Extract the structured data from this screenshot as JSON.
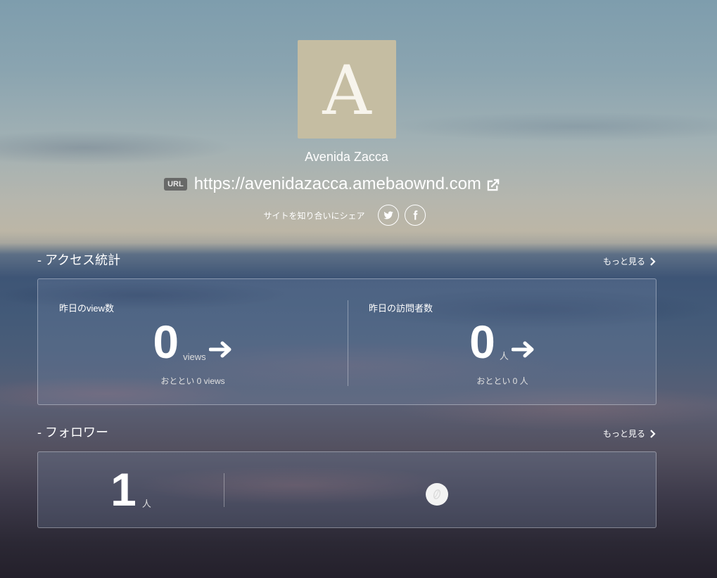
{
  "profile": {
    "avatar_letter": "A",
    "name": "Avenida Zacca",
    "url_badge": "URL",
    "url": "https://avenidazacca.amebaownd.com",
    "share_label": "サイトを知り合いにシェア",
    "social_icons": [
      "twitter-icon",
      "facebook-icon"
    ]
  },
  "access": {
    "title": "- アクセス統計",
    "more": "もっと見る",
    "views": {
      "title": "昨日のview数",
      "value": "0",
      "unit": "views",
      "sub": "おととい 0 views"
    },
    "visitors": {
      "title": "昨日の訪問者数",
      "value": "0",
      "unit": "人",
      "sub": "おととい 0 人"
    }
  },
  "followers": {
    "title": "- フォロワー",
    "more": "もっと見る",
    "count": "1",
    "unit": "人"
  },
  "colors": {
    "avatar_bg": "#c5bda2",
    "text": "#ffffff"
  }
}
